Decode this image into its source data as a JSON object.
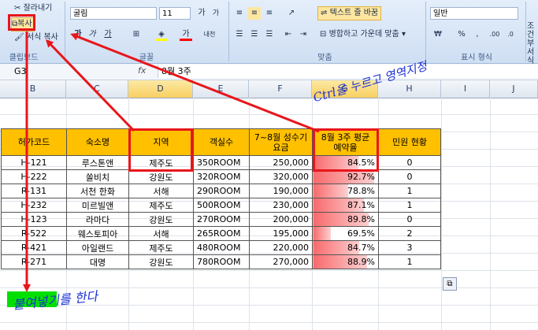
{
  "ribbon": {
    "clipboard": {
      "cut": "잘라내기",
      "copy": "복사",
      "painter": "서식 복사",
      "label": "클립보드"
    },
    "font": {
      "name": "굴림",
      "size": "11",
      "grow": "가",
      "shrink": "가",
      "bold": "가",
      "italic": "가",
      "underline": "가",
      "color_letter": "가",
      "label": "글꼴"
    },
    "align": {
      "wrap": "텍스트 줄 바꿈",
      "merge": "병합하고 가운데 맞춤",
      "label": "맞춤"
    },
    "number": {
      "format": "일반",
      "currency": "₩",
      "percent": "%",
      "comma": ",",
      "label": "표시 형식"
    },
    "styles": {
      "cond": "조건부 서식",
      "label_short": "서"
    }
  },
  "formula_bar": {
    "cell_ref": "G3",
    "fx": "fx",
    "value": "8월 3주"
  },
  "columns": [
    "B",
    "C",
    "D",
    "E",
    "F",
    "G",
    "H",
    "I",
    "J"
  ],
  "table": {
    "headers": [
      "허가코드",
      "숙소명",
      "지역",
      "객실수",
      "7~8월 성수기요금",
      "8월 3주 평균 예약율",
      "민원 현황"
    ],
    "rows": [
      {
        "code": "H-121",
        "name": "루스톤앤",
        "region": "제주도",
        "rooms": "350ROOM",
        "price": "250,000",
        "rate": "84.5%",
        "rate_val": 84.5,
        "complaints": "0"
      },
      {
        "code": "H-222",
        "name": "쏠비치",
        "region": "강원도",
        "rooms": "320ROOM",
        "price": "320,000",
        "rate": "92.7%",
        "rate_val": 92.7,
        "complaints": "0"
      },
      {
        "code": "R-131",
        "name": "서천 한화",
        "region": "서해",
        "rooms": "290ROOM",
        "price": "190,000",
        "rate": "78.8%",
        "rate_val": 78.8,
        "complaints": "1"
      },
      {
        "code": "H-232",
        "name": "미르빌앤",
        "region": "제주도",
        "rooms": "500ROOM",
        "price": "230,000",
        "rate": "87.1%",
        "rate_val": 87.1,
        "complaints": "1"
      },
      {
        "code": "H-123",
        "name": "라마다",
        "region": "강원도",
        "rooms": "270ROOM",
        "price": "200,000",
        "rate": "89.8%",
        "rate_val": 89.8,
        "complaints": "0"
      },
      {
        "code": "R-522",
        "name": "웨스토피아",
        "region": "서해",
        "rooms": "265ROOM",
        "price": "195,000",
        "rate": "69.5%",
        "rate_val": 69.5,
        "complaints": "2"
      },
      {
        "code": "R-421",
        "name": "아일랜드",
        "region": "제주도",
        "rooms": "480ROOM",
        "price": "220,000",
        "rate": "84.7%",
        "rate_val": 84.7,
        "complaints": "3"
      },
      {
        "code": "R-271",
        "name": "대명",
        "region": "강원도",
        "rooms": "780ROOM",
        "price": "270,000",
        "rate": "88.9%",
        "rate_val": 88.9,
        "complaints": "1"
      }
    ]
  },
  "annotations": {
    "ctrl_note": "Ctrl을 누르고 영역지정",
    "paste_note": "붙여넣기를 한다"
  },
  "colors": {
    "header_fill": "#ffc000",
    "databar": "#f8696b",
    "annot_red": "#e8161b",
    "paste_green": "#00e000"
  }
}
